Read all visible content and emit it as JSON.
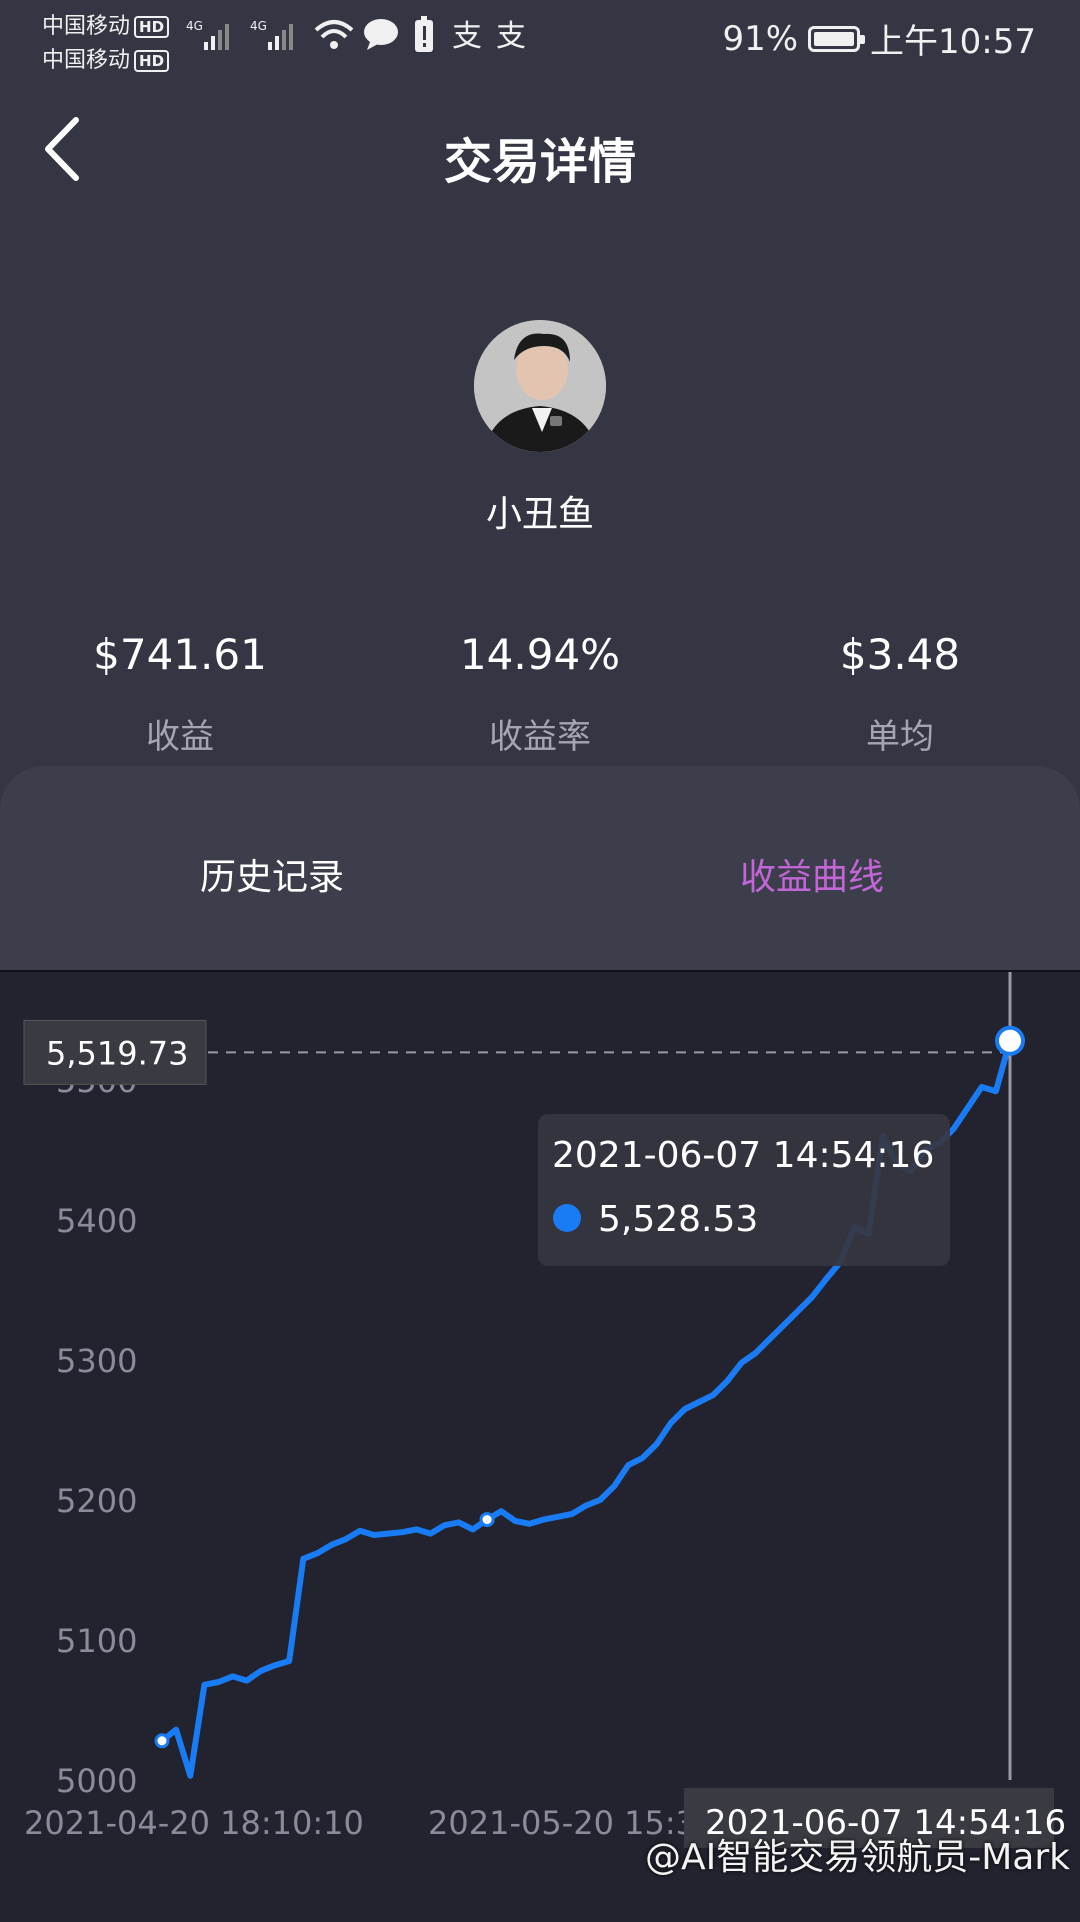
{
  "status_bar": {
    "carrier1": "中国移动",
    "carrier2": "中国移动",
    "hd": "HD",
    "network": "4G",
    "battery_pct": "91%",
    "time": "上午10:57",
    "icons": [
      "signal-icon",
      "wifi-icon",
      "message-icon",
      "battery-warning-icon",
      "alipay-icon"
    ]
  },
  "header": {
    "title": "交易详情",
    "back_icon": "chevron-left-icon"
  },
  "profile": {
    "name": "小丑鱼"
  },
  "stats": [
    {
      "value": "$741.61",
      "label": "收益"
    },
    {
      "value": "14.94%",
      "label": "收益率"
    },
    {
      "value": "$3.48",
      "label": "单均"
    }
  ],
  "tabs": [
    {
      "label": "历史记录",
      "active": false
    },
    {
      "label": "收益曲线",
      "active": true
    }
  ],
  "chart_data": {
    "type": "line",
    "x_labels": [
      "2021-04-20 18:10:10",
      "2021-05-20 15:3",
      "2021-06-07 14:54:16"
    ],
    "yticks": [
      5000,
      5100,
      5200,
      5300,
      5400,
      5500
    ],
    "ylim": [
      5000,
      5560
    ],
    "crosshair_value": "5,519.73",
    "tooltip": {
      "time": "2021-06-07 14:54:16",
      "value": "5,528.53"
    },
    "series": [
      {
        "color": "#1a7cf5",
        "values": [
          5028,
          5036,
          5003,
          5068,
          5070,
          5074,
          5071,
          5078,
          5082,
          5085,
          5158,
          5162,
          5168,
          5172,
          5178,
          5175,
          5176,
          5177,
          5179,
          5176,
          5182,
          5184,
          5179,
          5186,
          5192,
          5185,
          5183,
          5186,
          5188,
          5190,
          5196,
          5200,
          5210,
          5225,
          5230,
          5240,
          5255,
          5265,
          5270,
          5275,
          5285,
          5298,
          5305,
          5315,
          5325,
          5335,
          5345,
          5358,
          5370,
          5395,
          5390,
          5460,
          5440,
          5435,
          5450,
          5455,
          5465,
          5480,
          5495,
          5492,
          5528
        ]
      }
    ]
  },
  "watermark": "@AI智能交易领航员-Mark"
}
